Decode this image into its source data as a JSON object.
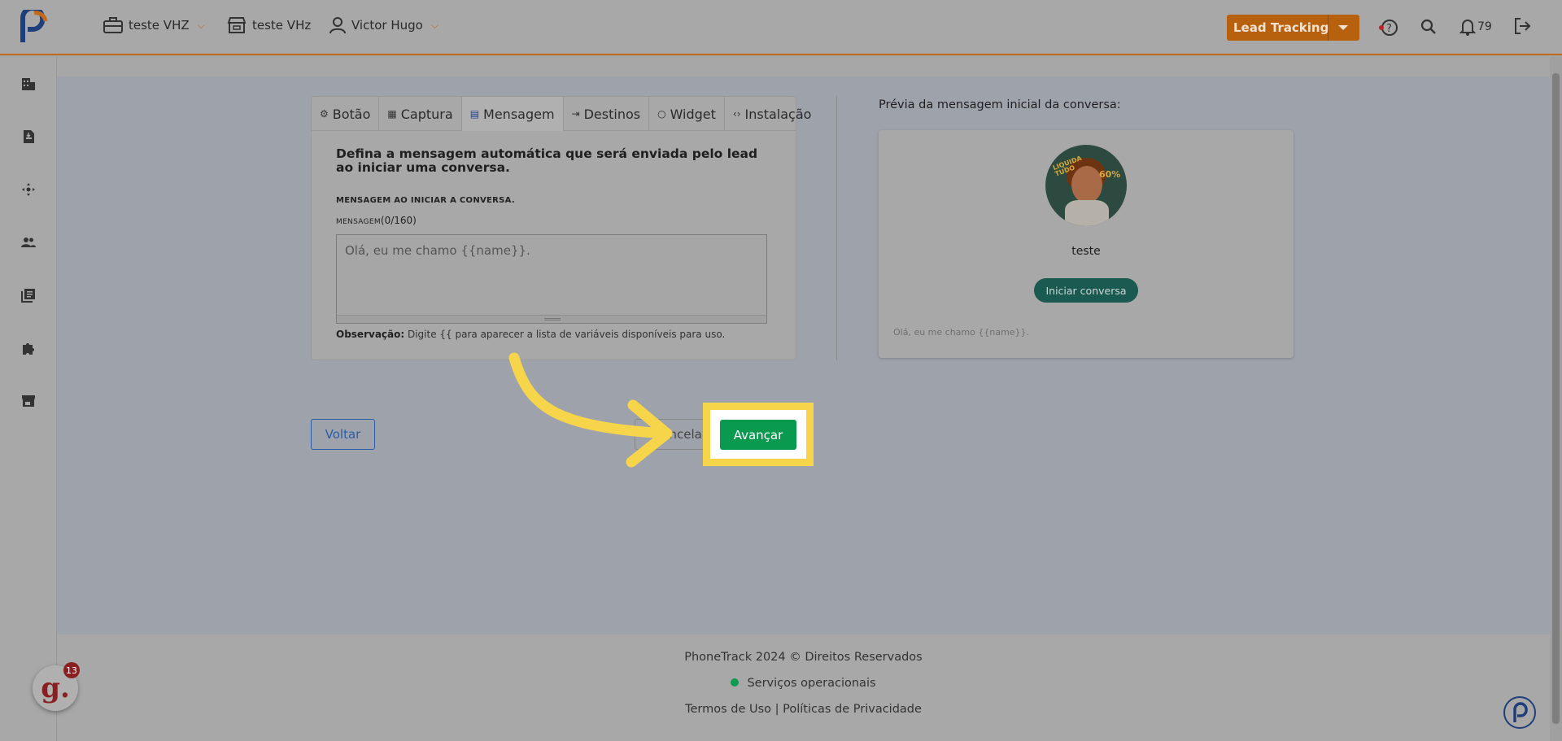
{
  "header": {
    "company_label": "teste VHZ",
    "store_label": "teste VHz",
    "user_label": "Victor Hugo",
    "lead_tracking_label": "Lead Tracking",
    "notifications_count": "79"
  },
  "tabs": [
    {
      "label": "Botão",
      "icon": "gear-icon"
    },
    {
      "label": "Captura",
      "icon": "grid-icon"
    },
    {
      "label": "Mensagem",
      "icon": "chat-icon",
      "active": true
    },
    {
      "label": "Destinos",
      "icon": "signin-icon"
    },
    {
      "label": "Widget",
      "icon": "whatsapp-icon"
    },
    {
      "label": "Instalação",
      "icon": "code-icon"
    }
  ],
  "form": {
    "description": "Defina a mensagem automática que será enviada pelo lead ao iniciar uma conversa.",
    "section_label": "MENSAGEM AO INICIAR A CONVERSA.",
    "message_label": "MENSAGEM",
    "message_count": "(0/160)",
    "message_placeholder": "Olá, eu me chamo {{name}}.",
    "observation_label": "Observação:",
    "observation_text": " Digite {{ para aparecer a lista de variáveis disponíveis para uso."
  },
  "preview": {
    "title": "Prévia da mensagem inicial da conversa:",
    "avatar_text_1": "LIQUIDA TUDO",
    "avatar_text_2": "60%",
    "name": "teste",
    "start_button": "Iniciar conversa",
    "message": "Olá, eu me chamo {{name}}."
  },
  "actions": {
    "back": "Voltar",
    "cancel": "Cancelar",
    "next": "Avançar"
  },
  "footer": {
    "copyright": "PhoneTrack 2024 © Direitos Reservados",
    "status": "Serviços operacionais",
    "terms": "Termos de Uso",
    "separator": "|",
    "privacy": "Políticas de Privacidade"
  },
  "widget": {
    "g_letter": "g.",
    "g_count": "13"
  },
  "colors": {
    "accent": "#c2691d",
    "success": "#0a9a4f",
    "highlight": "#f7d54a",
    "primary": "#2b5ea4"
  }
}
